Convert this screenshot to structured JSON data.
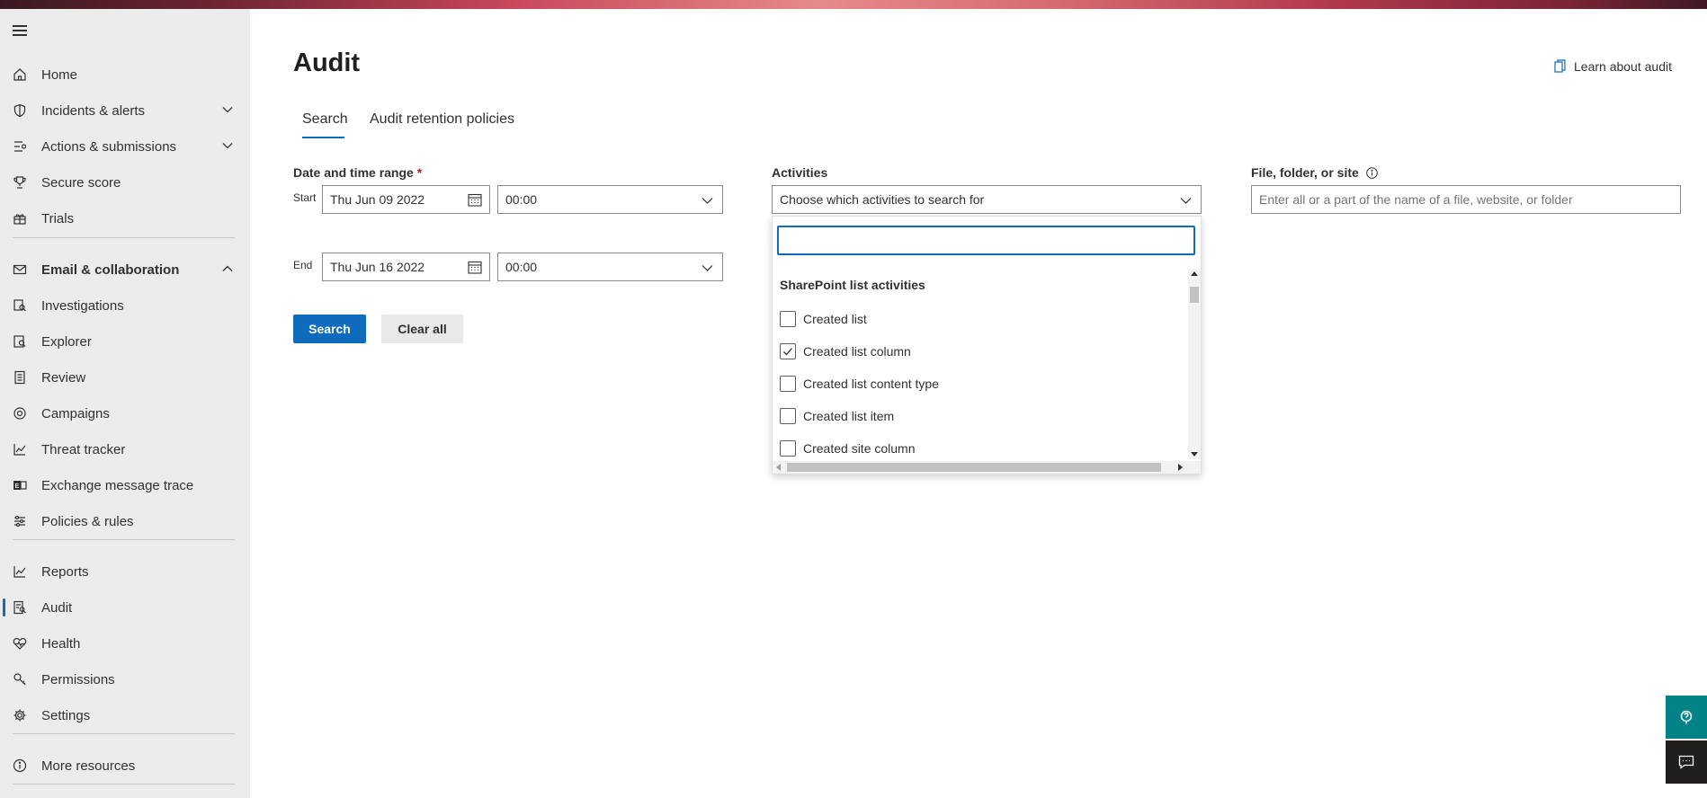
{
  "sidebar": {
    "items": [
      {
        "label": "Home",
        "icon": "home-icon"
      },
      {
        "label": "Incidents & alerts",
        "icon": "shield-icon",
        "expandable": true
      },
      {
        "label": "Actions & submissions",
        "icon": "actions-icon",
        "expandable": true
      },
      {
        "label": "Secure score",
        "icon": "trophy-icon"
      },
      {
        "label": "Trials",
        "icon": "trials-icon"
      },
      {
        "label": "Email & collaboration",
        "icon": "mail-icon",
        "expanded": true
      },
      {
        "label": "Investigations",
        "icon": "investigations-icon"
      },
      {
        "label": "Explorer",
        "icon": "explorer-icon"
      },
      {
        "label": "Review",
        "icon": "review-icon"
      },
      {
        "label": "Campaigns",
        "icon": "campaigns-icon"
      },
      {
        "label": "Threat tracker",
        "icon": "chart-line-icon"
      },
      {
        "label": "Exchange message trace",
        "icon": "exchange-icon"
      },
      {
        "label": "Policies & rules",
        "icon": "sliders-icon"
      },
      {
        "label": "Reports",
        "icon": "reports-icon"
      },
      {
        "label": "Audit",
        "icon": "audit-icon",
        "active": true
      },
      {
        "label": "Health",
        "icon": "heart-icon"
      },
      {
        "label": "Permissions",
        "icon": "key-icon"
      },
      {
        "label": "Settings",
        "icon": "gear-icon"
      },
      {
        "label": "More resources",
        "icon": "info-icon"
      }
    ]
  },
  "page": {
    "title": "Audit",
    "learn_link": "Learn about audit"
  },
  "tabs": [
    {
      "label": "Search",
      "selected": true
    },
    {
      "label": "Audit retention policies"
    }
  ],
  "form": {
    "date_label": "Date and time range",
    "required_mark": "*",
    "start_label": "Start",
    "end_label": "End",
    "start_date": "Thu Jun 09 2022",
    "start_time": "00:00",
    "end_date": "Thu Jun 16 2022",
    "end_time": "00:00",
    "activities_label": "Activities",
    "activities_placeholder": "Choose which activities to search for",
    "file_label": "File, folder, or site",
    "file_placeholder": "Enter all or a part of the name of a file, website, or folder",
    "search_button": "Search",
    "clear_button": "Clear all"
  },
  "activities_dropdown": {
    "search_value": "",
    "group": "SharePoint list activities",
    "options": [
      {
        "label": "Created list",
        "checked": false
      },
      {
        "label": "Created list column",
        "checked": true
      },
      {
        "label": "Created list content type",
        "checked": false
      },
      {
        "label": "Created list item",
        "checked": false
      },
      {
        "label": "Created site column",
        "checked": false
      }
    ]
  },
  "colors": {
    "accent": "#0f6cbd",
    "sidebar_bg": "#ececec",
    "help_button": "#038387"
  }
}
